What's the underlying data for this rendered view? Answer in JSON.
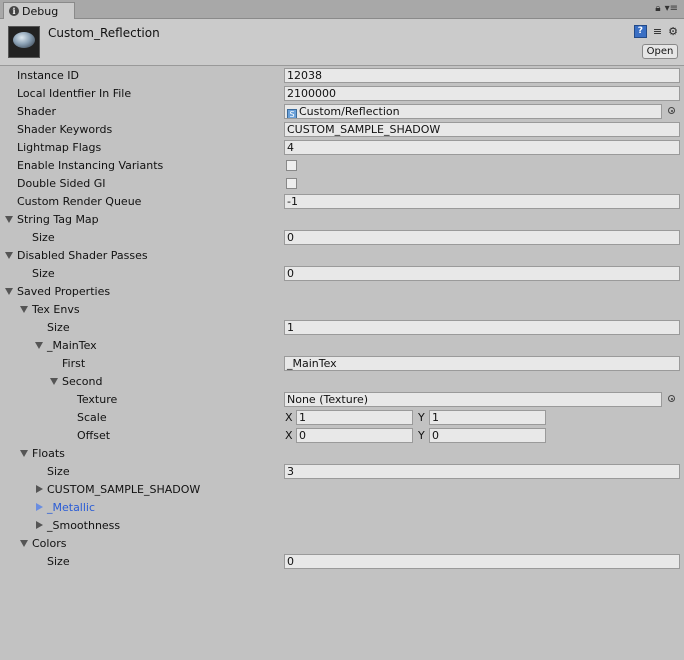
{
  "tab": {
    "title": "Debug"
  },
  "header": {
    "title": "Custom_Reflection",
    "open_label": "Open"
  },
  "props": {
    "instance_id": {
      "label": "Instance ID",
      "value": "12038"
    },
    "local_id": {
      "label": "Local Identfier In File",
      "value": "2100000"
    },
    "shader": {
      "label": "Shader",
      "value": "Custom/Reflection"
    },
    "keywords": {
      "label": "Shader Keywords",
      "value": "CUSTOM_SAMPLE_SHADOW"
    },
    "lightmap": {
      "label": "Lightmap Flags",
      "value": "4"
    },
    "instancing": {
      "label": "Enable Instancing Variants",
      "checked": false
    },
    "double_gi": {
      "label": "Double Sided GI",
      "checked": false
    },
    "render_queue": {
      "label": "Custom Render Queue",
      "value": "-1"
    },
    "string_tag_map": {
      "label": "String Tag Map",
      "size_label": "Size",
      "size": "0"
    },
    "disabled_passes": {
      "label": "Disabled Shader Passes",
      "size_label": "Size",
      "size": "0"
    },
    "saved": {
      "label": "Saved Properties",
      "tex_envs": {
        "label": "Tex Envs",
        "size_label": "Size",
        "size": "1",
        "maintex": {
          "label": "_MainTex",
          "first_label": "First",
          "first": "_MainTex",
          "second_label": "Second",
          "texture_label": "Texture",
          "texture": "None (Texture)",
          "scale_label": "Scale",
          "scale_x": "1",
          "scale_y": "1",
          "offset_label": "Offset",
          "offset_x": "0",
          "offset_y": "0",
          "x_label": "X",
          "y_label": "Y"
        }
      },
      "floats": {
        "label": "Floats",
        "size_label": "Size",
        "size": "3",
        "items": [
          "CUSTOM_SAMPLE_SHADOW",
          "_Metallic",
          "_Smoothness"
        ]
      },
      "colors": {
        "label": "Colors",
        "size_label": "Size",
        "size": "0"
      }
    }
  }
}
